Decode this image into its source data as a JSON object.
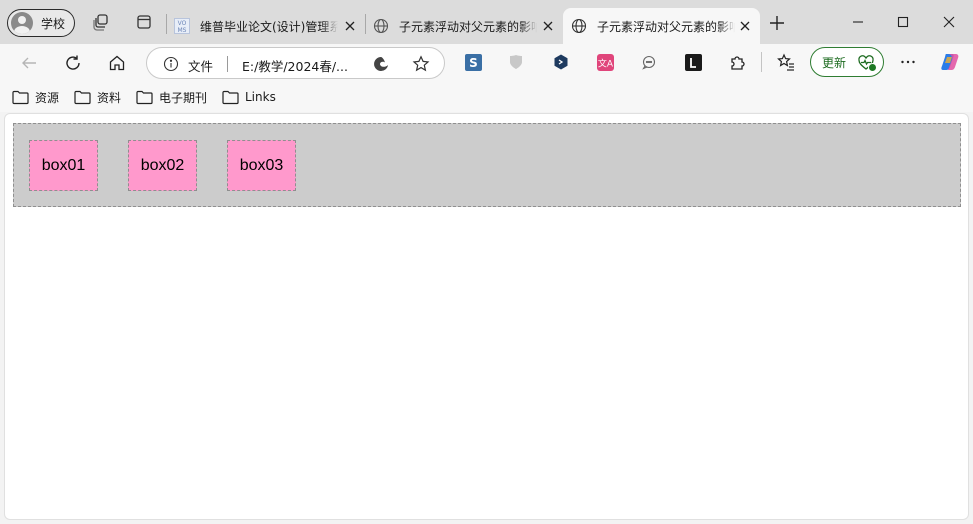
{
  "browser": {
    "profile_label": "学校",
    "tabs": [
      {
        "title": "维普毕业论文(设计)管理系统"
      },
      {
        "title": "子元素浮动对父元素的影响"
      },
      {
        "title": "子元素浮动对父元素的影响"
      }
    ],
    "address": {
      "scheme_label": "文件",
      "url": "E:/教学/2024春/..."
    },
    "update_label": "更新",
    "bookmarks": [
      "资源",
      "资料",
      "电子期刊",
      "Links"
    ]
  },
  "page": {
    "boxes": [
      "box01",
      "box02",
      "box03"
    ]
  },
  "colors": {
    "parent_bg": "#cccccc",
    "child_bg": "#ff99cc",
    "update_green": "#2f7d32"
  },
  "icons": [
    "profile-avatar-icon",
    "workspaces-icon",
    "tab-actions-icon",
    "globe-icon",
    "close-icon",
    "new-tab-icon",
    "minimize-icon",
    "maximize-icon",
    "window-close-icon",
    "back-icon",
    "refresh-icon",
    "home-icon",
    "info-icon",
    "edge-icon",
    "favorite-star-icon",
    "extension-icons",
    "favorites-icon",
    "more-icon",
    "copilot-icon",
    "folder-icon"
  ]
}
